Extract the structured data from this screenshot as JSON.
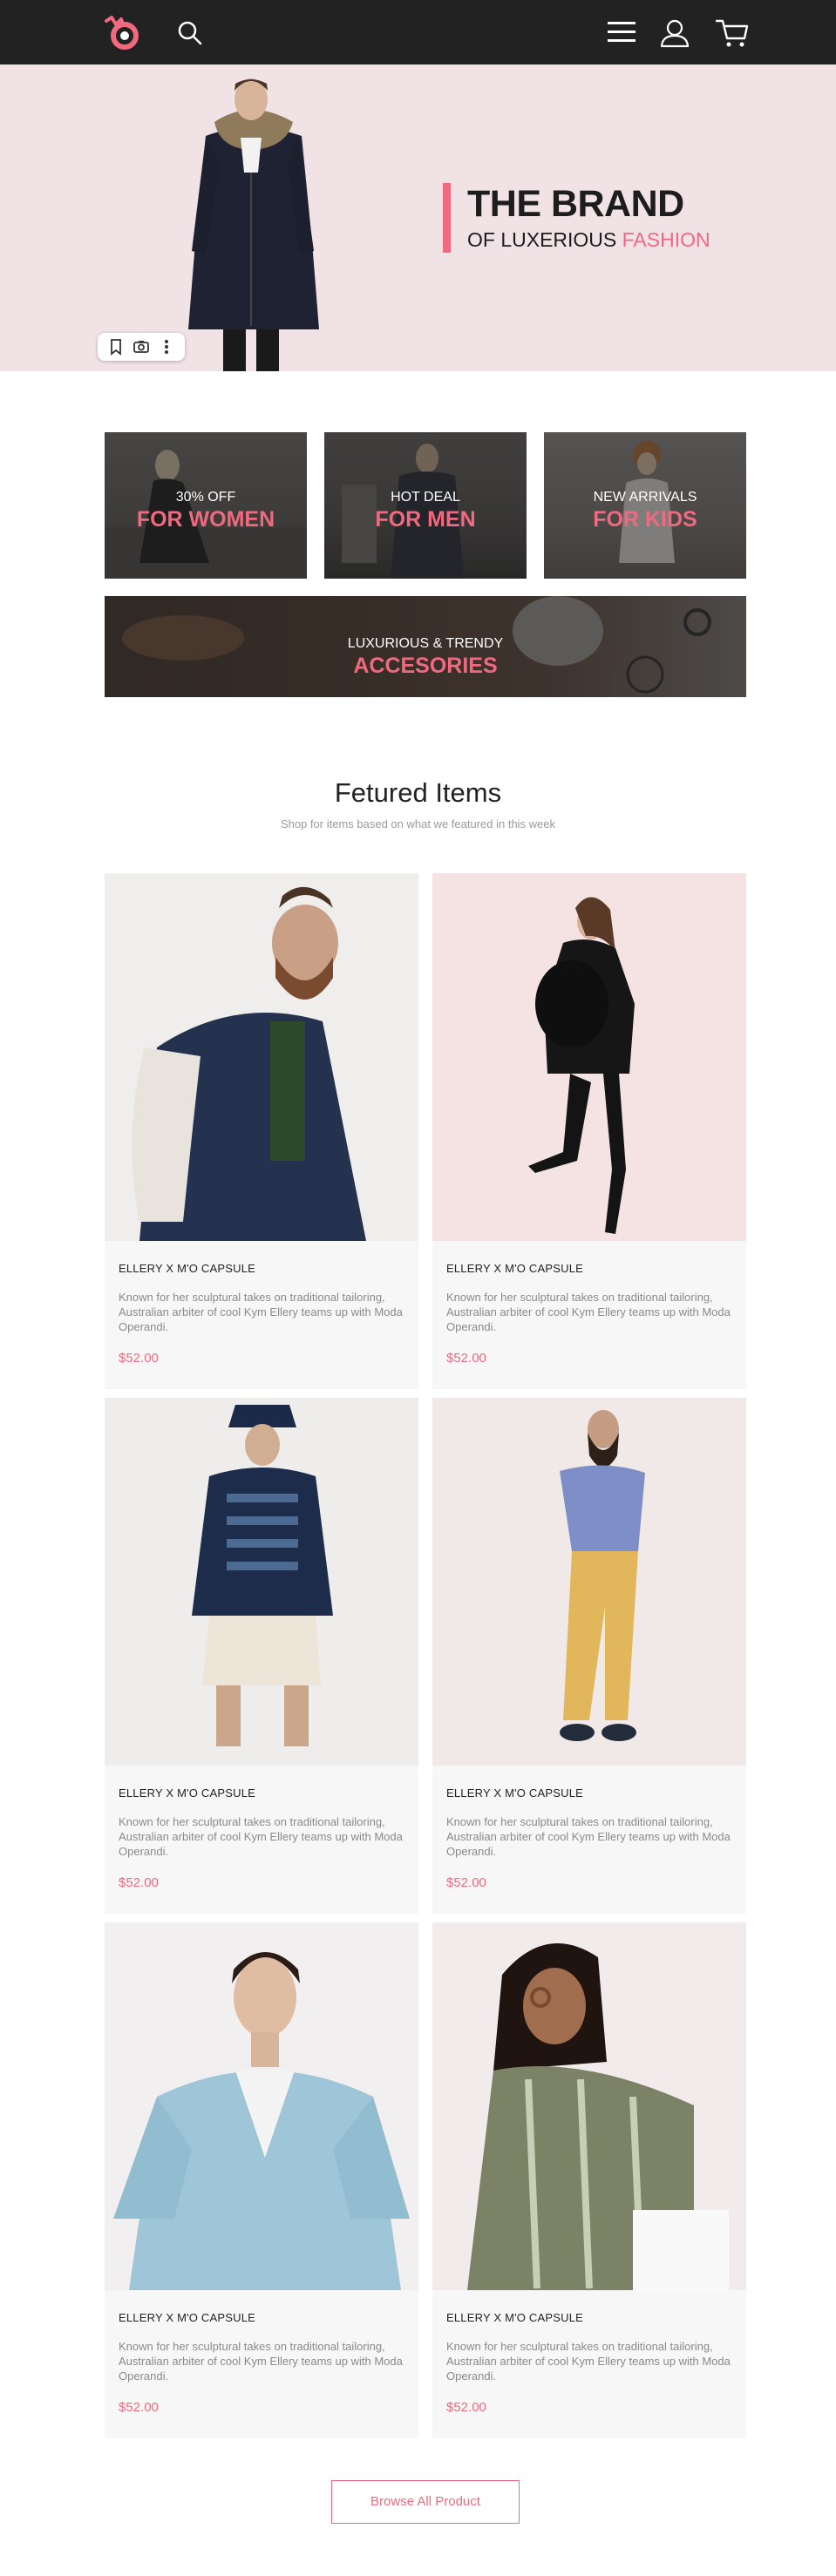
{
  "nav": {
    "logo_icon": "brand-logo-icon",
    "search_icon": "search-icon",
    "menu_icon": "hamburger-menu-icon",
    "user_icon": "user-icon",
    "cart_icon": "cart-icon",
    "bar_color": "#222222"
  },
  "hero": {
    "title": "THE BRAND",
    "subtitle_prefix": "OF LUXERIOUS ",
    "subtitle_accent": "FASHION",
    "background": "#f1e2e6",
    "tools": [
      "bookmark-icon",
      "camera-icon",
      "more-vertical-icon"
    ]
  },
  "categories": [
    {
      "small": "30% OFF",
      "big": "FOR WOMEN"
    },
    {
      "small": "HOT DEAL",
      "big": "FOR MEN"
    },
    {
      "small": "NEW ARRIVALS",
      "big": "FOR KIDS"
    },
    {
      "small": "LUXURIOUS & TRENDY",
      "big": "ACCESORIES"
    }
  ],
  "featured": {
    "title": "Fetured Items",
    "subtitle": "Shop for items based on what we featured in this week",
    "items": [
      {
        "name": "ELLERY X M'O CAPSULE",
        "desc": "Known for her sculptural takes on traditional tailoring, Australian arbiter of cool Kym Ellery teams up with Moda Operandi.",
        "price": "$52.00"
      },
      {
        "name": "ELLERY X M'O CAPSULE",
        "desc": "Known for her sculptural takes on traditional tailoring, Australian arbiter of cool Kym Ellery teams up with Moda Operandi.",
        "price": "$52.00"
      },
      {
        "name": "ELLERY X M'O CAPSULE",
        "desc": "Known for her sculptural takes on traditional tailoring, Australian arbiter of cool Kym Ellery teams up with Moda Operandi.",
        "price": "$52.00"
      },
      {
        "name": "ELLERY X M'O CAPSULE",
        "desc": "Known for her sculptural takes on traditional tailoring, Australian arbiter of cool Kym Ellery teams up with Moda Operandi.",
        "price": "$52.00"
      },
      {
        "name": "ELLERY X M'O CAPSULE",
        "desc": "Known for her sculptural takes on traditional tailoring, Australian arbiter of cool Kym Ellery teams up with Moda Operandi.",
        "price": "$52.00"
      },
      {
        "name": "ELLERY X M'O CAPSULE",
        "desc": "Known for her sculptural takes on traditional tailoring, Australian arbiter of cool Kym Ellery teams up with Moda Operandi.",
        "price": "$52.00"
      }
    ]
  },
  "browse_label": "Browse All Product",
  "colors": {
    "accent": "#f0697f",
    "card_bg": "#f7f7f7",
    "text": "#222222",
    "muted": "#8a8a8a"
  }
}
